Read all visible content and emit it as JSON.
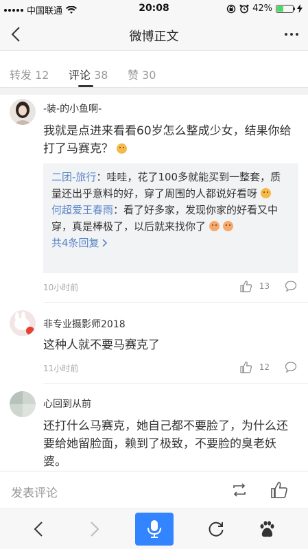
{
  "status_bar": {
    "carrier": "中国联通",
    "time": "20:08",
    "battery_percent": "42%",
    "battery_level": 0.42
  },
  "nav": {
    "title": "微博正文"
  },
  "tabs": [
    {
      "label": "转发",
      "count": "12"
    },
    {
      "label": "评论",
      "count": "38"
    },
    {
      "label": "赞",
      "count": "30"
    }
  ],
  "comments": [
    {
      "author": "-装-的小鱼啊-",
      "text": "我就是点进来看看60岁怎么整成少女，结果你给打了马赛克？",
      "time": "10小时前",
      "likes": "13",
      "replies": [
        {
          "author": "二团-旅行",
          "sep": "：",
          "text": "哇哇，花了100多就能买到一整套，质量还出乎意料的好，穿了周围的人都说好看呀"
        },
        {
          "author": "何超爱王春雨",
          "sep": "：",
          "text": "看了好多家，发现你家的好看又中穿，真是棒极了，以后就来找你了"
        }
      ],
      "more_replies": "共4条回复"
    },
    {
      "author": "非专业摄影师2018",
      "text": "这种人就不要马赛克了",
      "time": "11小时前",
      "likes": "12"
    },
    {
      "author": "心回到从前",
      "text": "还打什么马赛克，她自己都不要脸了，为什么还要给她留脸面，赖到了极致，不要脸的臭老妖婆。"
    }
  ],
  "input_bar": {
    "placeholder": "发表评论"
  },
  "colors": {
    "link_blue": "#5a86c7",
    "accent_blue": "#3385ff",
    "battery_green": "#4cd964"
  }
}
